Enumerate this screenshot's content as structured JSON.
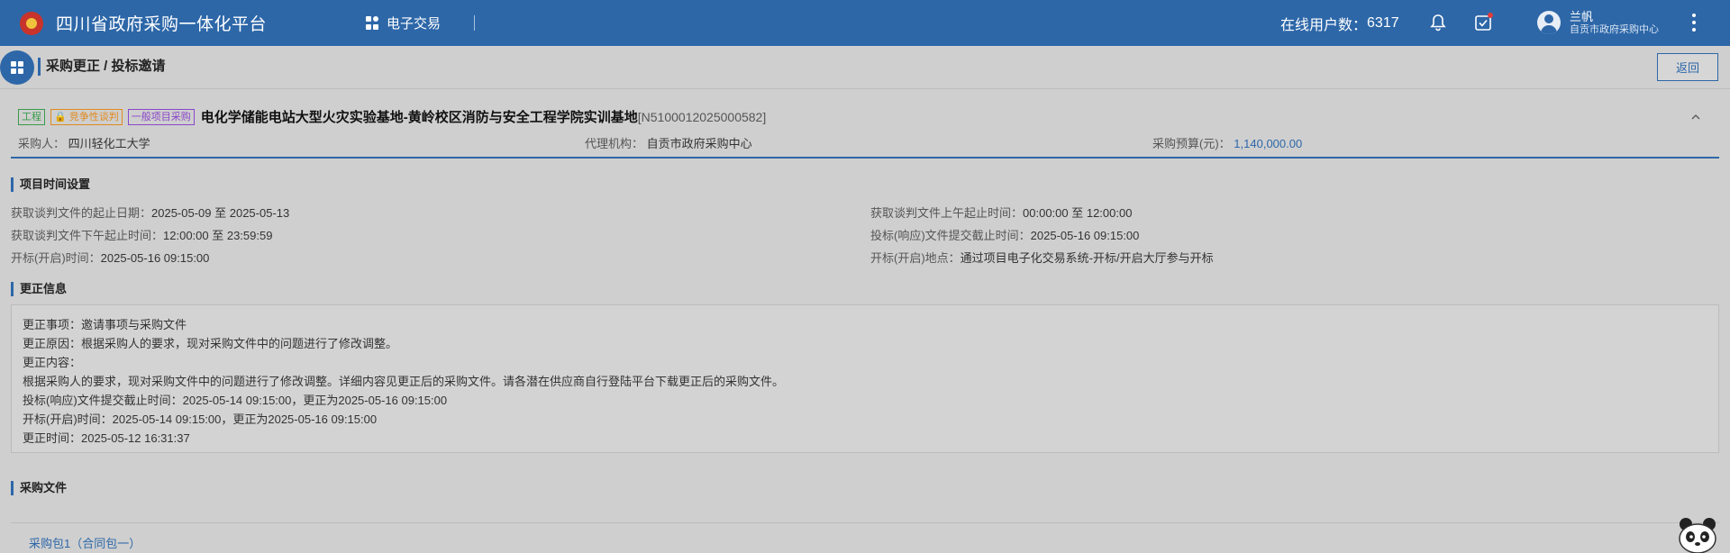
{
  "header": {
    "brand": "四川省政府采购一体化平台",
    "menu_trade": "电子交易",
    "online_label": "在线用户数：",
    "online_count": "6317",
    "user_name": "兰帆",
    "user_org": "自贡市政府采购中心"
  },
  "page": {
    "title": "采购更正 / 投标邀请",
    "back_label": "返回"
  },
  "project": {
    "tags": [
      "工程",
      "竞争性谈判",
      "一般项目采购"
    ],
    "title": "电化学储能电站大型火灾实验基地-黄岭校区消防与安全工程学院实训基地",
    "code": "[N5100012025000582]",
    "purchaser_label": "采购人：",
    "purchaser": "四川轻化工大学",
    "agency_label": "代理机构：",
    "agency": "自贡市政府采购中心",
    "budget_label": "采购预算(元)：",
    "budget": "1,140,000.00"
  },
  "time_section": {
    "title": "项目时间设置",
    "rows": [
      {
        "label": "获取谈判文件的起止日期：",
        "value": "2025-05-09 至 2025-05-13"
      },
      {
        "label": "获取谈判文件上午起止时间：",
        "value": "00:00:00 至 12:00:00"
      },
      {
        "label": "获取谈判文件下午起止时间：",
        "value": "12:00:00 至 23:59:59"
      },
      {
        "label": "投标(响应)文件提交截止时间：",
        "value": "2025-05-16 09:15:00"
      },
      {
        "label": "开标(开启)时间：",
        "value": "2025-05-16 09:15:00"
      },
      {
        "label": "开标(开启)地点：",
        "value": "通过项目电子化交易系统-开标/开启大厅参与开标"
      }
    ]
  },
  "correction_section": {
    "title": "更正信息",
    "lines": [
      "更正事项：邀请事项与采购文件",
      "更正原因：根据采购人的要求，现对采购文件中的问题进行了修改调整。",
      "更正内容：",
      "根据采购人的要求，现对采购文件中的问题进行了修改调整。详细内容见更正后的采购文件。请各潜在供应商自行登陆平台下载更正后的采购文件。",
      "投标(响应)文件提交截止时间：2025-05-14 09:15:00，更正为2025-05-16 09:15:00",
      "开标(开启)时间：2025-05-14 09:15:00，更正为2025-05-16 09:15:00",
      "更正时间：2025-05-12 16:31:37"
    ]
  },
  "files_section": {
    "title": "采购文件",
    "tab": "采购包1（合同包一）"
  },
  "colors": {
    "primary": "#2d67a8",
    "background": "#cfcfcf",
    "tag_green": "#3a9b4b",
    "tag_orange": "#e08a1e",
    "tag_purple": "#8a47c9"
  }
}
